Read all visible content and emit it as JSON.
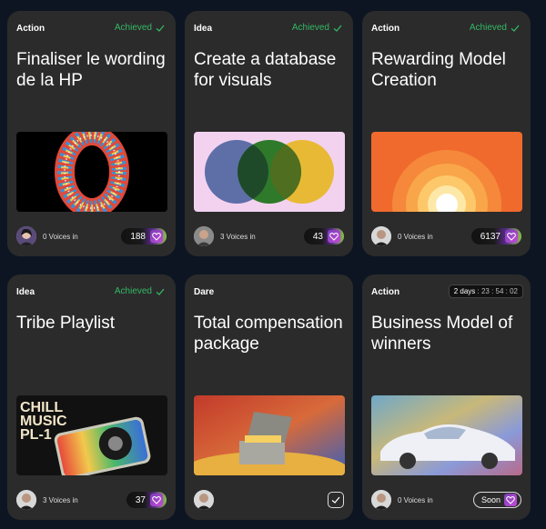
{
  "cards": [
    {
      "tag": "Action",
      "status": "Achieved",
      "title": "Finaliser le wording de la HP",
      "voices": "0 Voices in",
      "count": "188",
      "media_icon": "striped-zero-image",
      "avatar_icon": "avatar-woman-icon"
    },
    {
      "tag": "Idea",
      "status": "Achieved",
      "title": "Create a database for visuals",
      "voices": "3 Voices in",
      "count": "43",
      "media_icon": "venn-circles-image",
      "avatar_icon": "avatar-man-icon"
    },
    {
      "tag": "Action",
      "status": "Achieved",
      "title": "Rewarding Model Creation",
      "voices": "0 Voices in",
      "count": "6137",
      "media_icon": "sunset-gradient-image",
      "avatar_icon": "avatar-man-icon"
    },
    {
      "tag": "Idea",
      "status": "Achieved",
      "title": "Tribe Playlist",
      "voices": "3 Voices in",
      "count": "37",
      "media_icon": "chill-music-image",
      "media_text": [
        "CHILL",
        "MUSIC",
        "PL-1"
      ],
      "avatar_icon": "avatar-man-icon"
    },
    {
      "tag": "Dare",
      "title": "Total compensation package",
      "media_icon": "treasure-chest-image",
      "avatar_icon": "avatar-man-icon",
      "action_icon": "check-button-icon"
    },
    {
      "tag": "Action",
      "timer": {
        "days": "2 days",
        "time": ": 23 : 54 : 02"
      },
      "title": "Business Model of winners",
      "voices": "0 Voices in",
      "soon": "Soon",
      "media_icon": "car-painting-image",
      "avatar_icon": "avatar-man-icon"
    }
  ],
  "colors": {
    "background": "#0d1522",
    "card": "#2b2b2b",
    "achieved": "#33b864",
    "heart": "#b146d0"
  }
}
